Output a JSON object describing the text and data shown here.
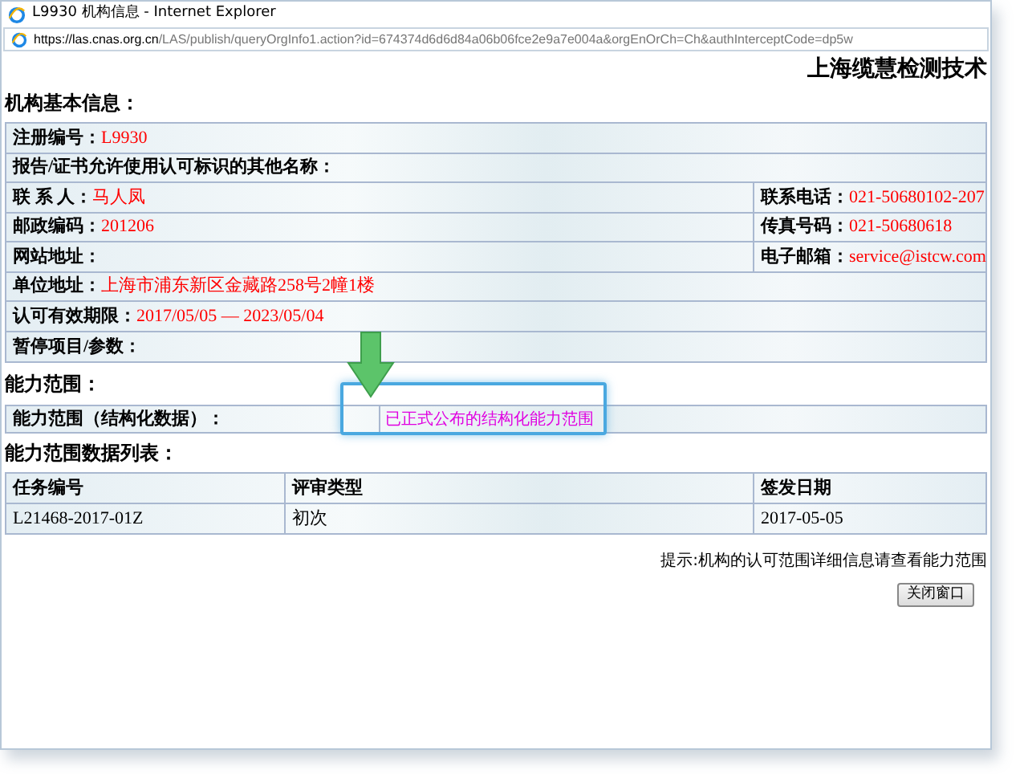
{
  "window": {
    "title": "L9930 机构信息 - Internet Explorer"
  },
  "address_bar": {
    "url_host": "https://las.cnas.org.cn",
    "url_path": "/LAS/publish/queryOrgInfo1.action?id=674374d6d6d84a06b06fce2e9a7e004a&orgEnOrCh=Ch&authInterceptCode=dp5w"
  },
  "org_name": "上海缆慧检测技术",
  "basic_info": {
    "heading": "机构基本信息：",
    "rows": [
      [
        {
          "label": "注册编号：",
          "value": "L9930"
        }
      ],
      [
        {
          "label": "报告/证书允许使用认可标识的其他名称："
        }
      ],
      [
        {
          "label": "联 系 人：",
          "value": "马人凤"
        },
        {
          "label": "联系电话：",
          "value": "021-50680102-207"
        }
      ],
      [
        {
          "label": "邮政编码：",
          "value": "201206"
        },
        {
          "label": "传真号码：",
          "value": "021-50680618"
        }
      ],
      [
        {
          "label": "网站地址："
        },
        {
          "label": "电子邮箱：",
          "value": "service@istcw.com"
        }
      ],
      [
        {
          "label": "单位地址：",
          "value": "上海市浦东新区金藏路258号2幢1楼"
        }
      ],
      [
        {
          "label": "认可有效期限：",
          "value": "2017/05/05 — 2023/05/04"
        }
      ],
      [
        {
          "label": "暂停项目/参数："
        }
      ]
    ]
  },
  "scope": {
    "heading": "能力范围：",
    "label": "能力范围（结构化数据）：",
    "link": "已正式公布的结构化能力范围"
  },
  "scope_list": {
    "heading": "能力范围数据列表：",
    "columns": [
      "任务编号",
      "评审类型",
      "签发日期"
    ],
    "rows": [
      [
        "L21468-2017-01Z",
        "初次",
        "2017-05-05"
      ]
    ]
  },
  "hint": "提示:机构的认可范围详细信息请查看能力范围",
  "close_button": "关闭窗口"
}
